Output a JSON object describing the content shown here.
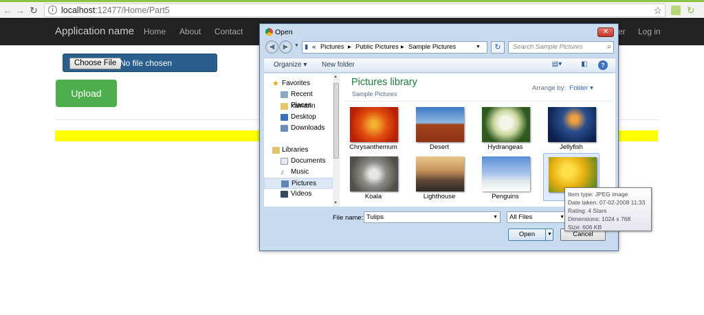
{
  "browser": {
    "url_host": "localhost",
    "url_rest": ":12477/Home/Part5",
    "accent": "#8bc34a"
  },
  "navbar": {
    "brand": "Application name",
    "links": [
      "Home",
      "About",
      "Contact"
    ],
    "partial_register": "er",
    "login": "Log in"
  },
  "page": {
    "choose_file_label": "Choose File",
    "no_file_text": "No file chosen",
    "upload_label": "Upload",
    "upload_color": "#4cae4c",
    "yellow_bar_color": "#ffff00"
  },
  "dialog": {
    "title": "Open",
    "close_label": "✕",
    "path": {
      "prefix": "«",
      "segments": [
        "Pictures",
        "Public Pictures",
        "Sample Pictures"
      ]
    },
    "search_placeholder": "Search Sample Pictures",
    "toolbar": {
      "organize": "Organize ▾",
      "new_folder": "New folder"
    },
    "nav": {
      "favorites": "Favorites",
      "recent": "Recent Places",
      "xamarin": "xamarin",
      "desktop": "Desktop",
      "downloads": "Downloads",
      "libraries": "Libraries",
      "documents": "Documents",
      "music": "Music",
      "pictures": "Pictures",
      "videos": "Videos"
    },
    "library_title": "Pictures library",
    "library_subtitle": "Sample Pictures",
    "arrange_label": "Arrange by:",
    "arrange_value": "Folder ▾",
    "thumbnails": [
      "Chrysanthemum",
      "Desert",
      "Hydrangeas",
      "Jellyfish",
      "Koala",
      "Lighthouse",
      "Penguins",
      "Tulips"
    ],
    "selected_thumbnail": "Tulips",
    "file_name_label": "File name:",
    "file_name_value": "Tulips",
    "filter_value": "All Files",
    "open_label": "Open",
    "cancel_label": "Cancel"
  },
  "tooltip": {
    "type": "Item type: JPEG image",
    "date": "Date taken: 07-02-2008 11:33",
    "rating": "Rating: 4 Stars",
    "dimensions": "Dimensions: 1024 x 768",
    "size": "Size: 606 KB"
  }
}
